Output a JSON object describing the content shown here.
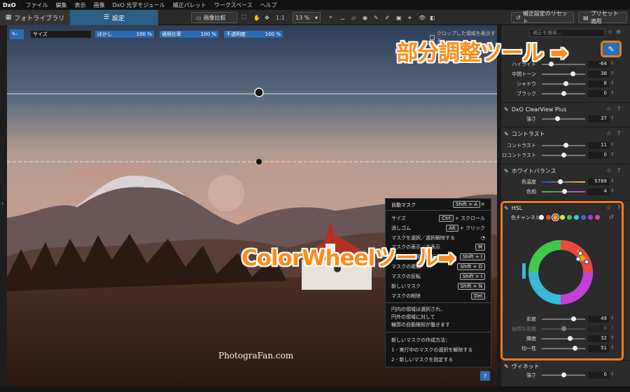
{
  "menu": {
    "logo": "DxO",
    "items": [
      "ファイル",
      "編集",
      "表示",
      "画像",
      "DxO 光学モジュール",
      "補正パレット",
      "ワークスペース",
      "ヘルプ"
    ]
  },
  "toolbar": {
    "tab_library": "フォトライブラリ",
    "tab_settings": "設定",
    "compare": "画像比較",
    "zoom_1to1": "1:1",
    "zoom_level": "13 %",
    "reset": "補正設定のリセット",
    "apply_preset": "プリセット適用"
  },
  "local_toolbar": {
    "size_label": "サイズ",
    "feather_label": "ぼかし",
    "feather_value": "100 %",
    "flow_label": "適用比率",
    "flow_value": "100 %",
    "opacity_label": "不透明度",
    "opacity_value": "100 %",
    "crop_label": "クロップした領域を表示する"
  },
  "help": {
    "title": "自動マスク",
    "title_key": "Shift + A",
    "rows": [
      {
        "label": "サイズ",
        "key": "Ctrl",
        "extra": "+ スクロール"
      },
      {
        "label": "消しゴム",
        "key": "Alt",
        "extra": "+ クリック"
      },
      {
        "label": "マスクを選択／選択解除する",
        "key": "",
        "extra": ""
      },
      {
        "label": "マスクの表示／非表示",
        "key": "M",
        "extra": ""
      },
      {
        "label": "マスクの適用を反転する",
        "key": "Shift + I",
        "extra": ""
      },
      {
        "label": "マスクの複製",
        "key": "Shift + D",
        "extra": ""
      },
      {
        "label": "マスクの反転",
        "key": "Shift + I",
        "extra": ""
      },
      {
        "label": "新しいマスク",
        "key": "Shift + N",
        "extra": ""
      },
      {
        "label": "マスクの削除",
        "key": "Del",
        "extra": ""
      }
    ],
    "desc1": "円内の領域は選択され、",
    "desc2": "円外の領域に対して",
    "desc3": "輪郭の自動検知が働きます",
    "new_title": "新しいマスクの作成方法：",
    "step1": "1 - 実行中のマスクの選択を解除する",
    "step2": "2 - 新しいマスクを指定する",
    "help_button": "?"
  },
  "watermark": "PhotograFan.com",
  "sidebar": {
    "search_placeholder": "補正を検索...",
    "tone_rows": [
      {
        "label": "ハイライト",
        "value": "-64",
        "pos": 0.22
      },
      {
        "label": "中間トーン",
        "value": "38",
        "pos": 0.72
      },
      {
        "label": "シャドウ",
        "value": "8",
        "pos": 0.55
      },
      {
        "label": "ブラック",
        "value": "0",
        "pos": 0.5
      }
    ],
    "clearview": {
      "title": "DxO ClearView Plus",
      "label": "強さ",
      "value": "37",
      "pos": 0.37
    },
    "contrast": {
      "title": "コントラスト",
      "rows": [
        {
          "label": "コントラスト",
          "value": "11",
          "pos": 0.55
        },
        {
          "label": "マイクロコントラスト",
          "value": "0",
          "pos": 0.5
        }
      ]
    },
    "wb": {
      "title": "ホワイトバランス",
      "rows": [
        {
          "label": "色温度",
          "value": "5789",
          "pos": 0.42
        },
        {
          "label": "色相",
          "value": "4",
          "pos": 0.52
        }
      ]
    },
    "hsl": {
      "title": "HSL",
      "channel_label": "色チャンネル",
      "channel_colors": [
        "#ffffff",
        "#e84a3c",
        "#f0a020",
        "#f2e040",
        "#42c84a",
        "#33d0d0",
        "#3a6ae8",
        "#a040e0",
        "#e040b0"
      ],
      "rows": [
        {
          "label": "彩度",
          "value": "49",
          "pos": 0.74
        },
        {
          "label": "自然な彩度",
          "value": "0",
          "pos": 0.5
        },
        {
          "label": "輝度",
          "value": "32",
          "pos": 0.66
        },
        {
          "label": "均一性",
          "value": "51",
          "pos": 0.76
        }
      ]
    },
    "next_section": {
      "title": "ヴィネット",
      "label": "強さ",
      "value": "0"
    }
  },
  "callouts": {
    "local_adjust": "部分調整ツール",
    "colorwheel": "ColorWheelツール"
  },
  "colors": {
    "accent": "#2a6db5",
    "highlight": "#ef7a1a",
    "callout": "#ff8c1a"
  }
}
